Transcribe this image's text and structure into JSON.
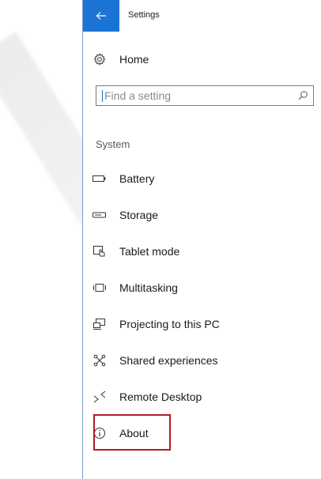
{
  "window": {
    "title": "Settings",
    "back_icon": "back-arrow-icon"
  },
  "home": {
    "label": "Home",
    "icon": "gear-icon"
  },
  "search": {
    "placeholder": "Find a setting",
    "icon": "search-icon"
  },
  "section": {
    "heading": "System"
  },
  "nav": {
    "items": [
      {
        "label": "Battery",
        "icon": "battery-icon"
      },
      {
        "label": "Storage",
        "icon": "storage-icon"
      },
      {
        "label": "Tablet mode",
        "icon": "tablet-mode-icon"
      },
      {
        "label": "Multitasking",
        "icon": "multitasking-icon"
      },
      {
        "label": "Projecting to this PC",
        "icon": "projecting-icon"
      },
      {
        "label": "Shared experiences",
        "icon": "shared-experiences-icon"
      },
      {
        "label": "Remote Desktop",
        "icon": "remote-desktop-icon"
      },
      {
        "label": "About",
        "icon": "info-icon",
        "highlighted": true
      }
    ]
  },
  "colors": {
    "accent": "#1b74d3",
    "highlight_border": "#b01c24",
    "window_border": "#7a9ccf"
  }
}
